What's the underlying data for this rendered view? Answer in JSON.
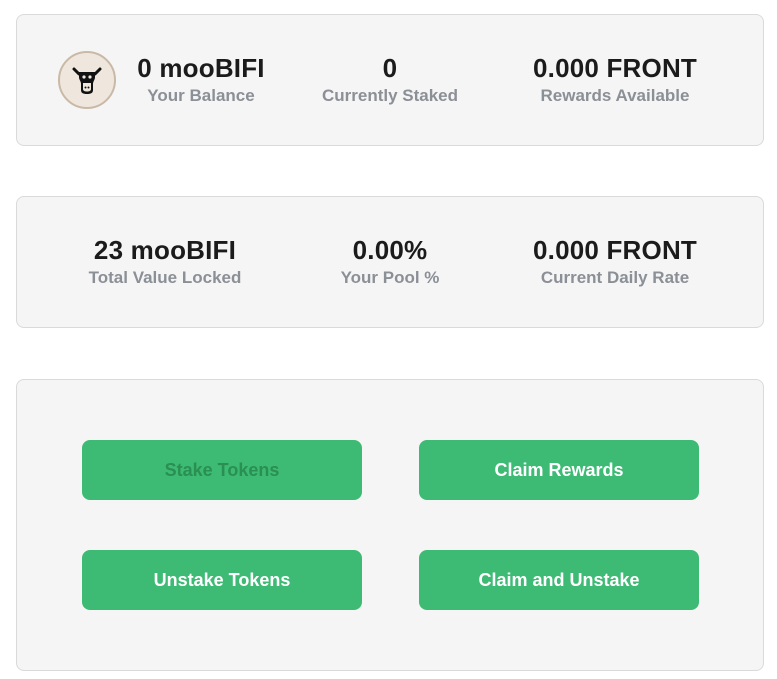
{
  "balance_card": {
    "token_icon": "moo-cow-head-icon",
    "balance": {
      "value": "0 mooBIFI",
      "label": "Your Balance"
    },
    "staked": {
      "value": "0",
      "label": "Currently Staked"
    },
    "rewards": {
      "value": "0.000 FRONT",
      "label": "Rewards Available"
    }
  },
  "pool_card": {
    "tvl": {
      "value": "23 mooBIFI",
      "label": "Total Value Locked"
    },
    "pool_pct": {
      "value": "0.00%",
      "label": "Your Pool %"
    },
    "daily_rate": {
      "value": "0.000 FRONT",
      "label": "Current Daily Rate"
    }
  },
  "actions": {
    "stake": {
      "label": "Stake Tokens",
      "disabled": true
    },
    "claim": {
      "label": "Claim Rewards",
      "disabled": false
    },
    "unstake": {
      "label": "Unstake Tokens",
      "disabled": false
    },
    "claim_unstake": {
      "label": "Claim and Unstake",
      "disabled": false
    }
  },
  "colors": {
    "card_bg": "#f5f5f5",
    "card_border": "#dadada",
    "button_green": "#3dbb74",
    "disabled_text": "#2a8f52",
    "value_text": "#1b1b1b",
    "label_text": "#8b8f96"
  }
}
